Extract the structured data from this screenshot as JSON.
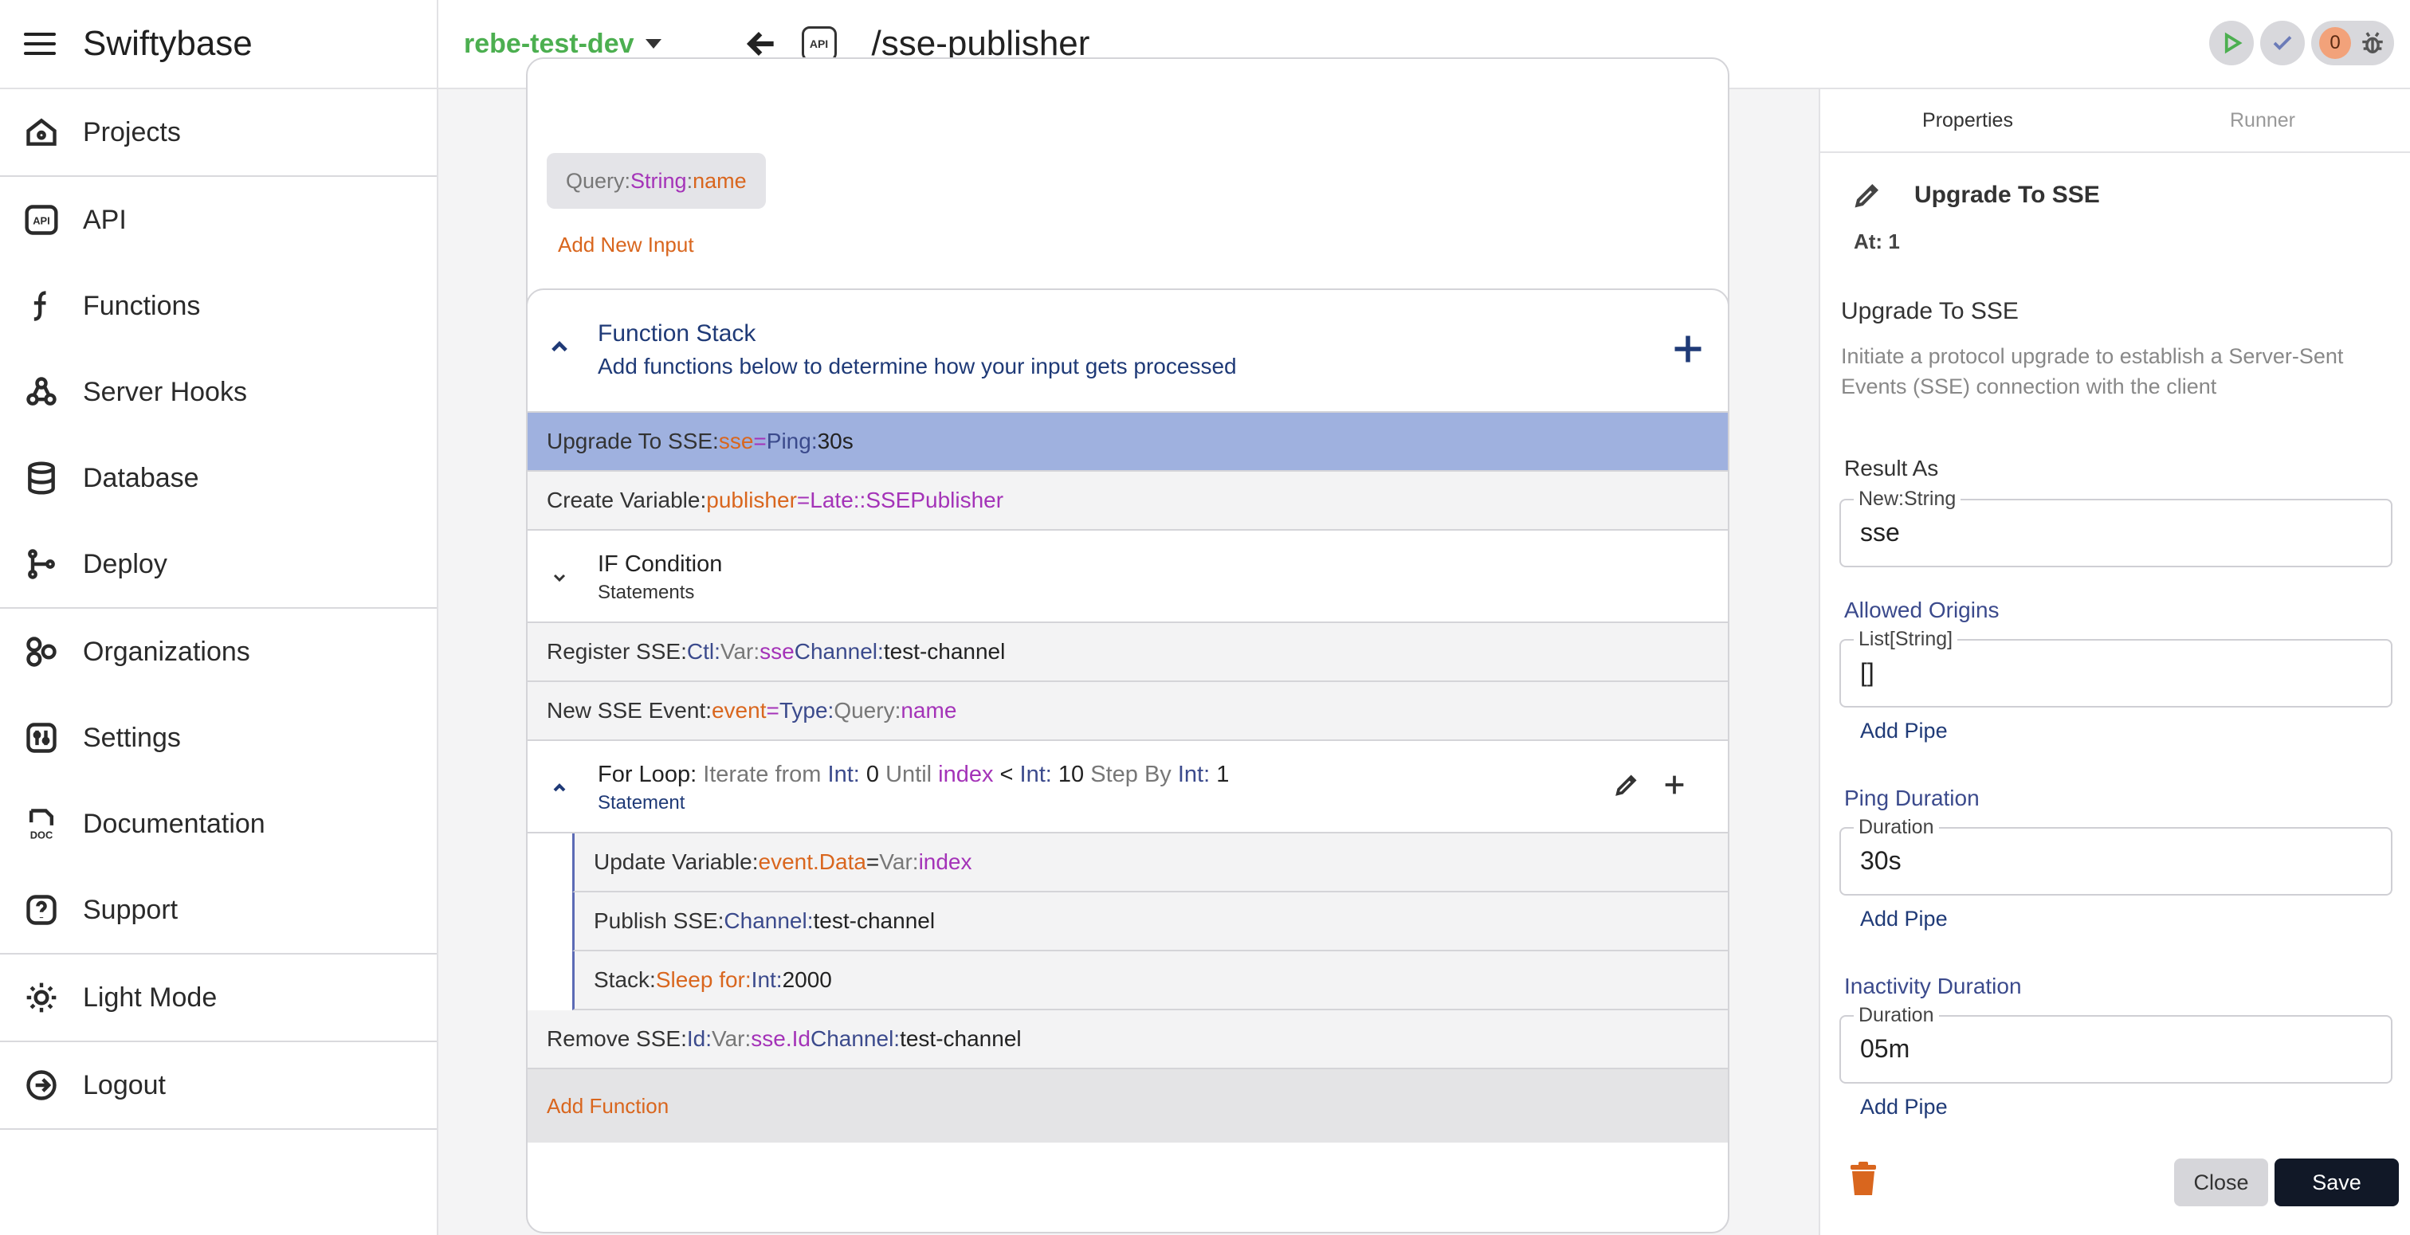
{
  "app": {
    "brand": "Swiftybase"
  },
  "sidebar": {
    "items": [
      {
        "label": "Projects",
        "icon": "home-icon"
      },
      {
        "label": "API",
        "icon": "api-icon"
      },
      {
        "label": "Functions",
        "icon": "function-icon"
      },
      {
        "label": "Server Hooks",
        "icon": "webhook-icon"
      },
      {
        "label": "Database",
        "icon": "database-icon"
      },
      {
        "label": "Deploy",
        "icon": "git-branch-icon"
      },
      {
        "label": "Organizations",
        "icon": "organization-icon"
      },
      {
        "label": "Settings",
        "icon": "settings-icon"
      },
      {
        "label": "Documentation",
        "icon": "doc-icon"
      },
      {
        "label": "Support",
        "icon": "help-icon"
      },
      {
        "label": "Light Mode",
        "icon": "sun-icon"
      },
      {
        "label": "Logout",
        "icon": "logout-icon"
      }
    ]
  },
  "topbar": {
    "project": "rebe-test-dev",
    "api_badge": "API",
    "path": "/sse-publisher",
    "error_count": "0"
  },
  "inputs": {
    "chip": {
      "k": "Query: ",
      "type": "String",
      "sep": ": ",
      "name": "name"
    },
    "add_label": "Add New Input"
  },
  "stack": {
    "title": "Function Stack",
    "subtitle": "Add functions below to determine how your input gets processed",
    "upgrade": {
      "k": "Upgrade To SSE: ",
      "var": "sse",
      "eq": " = ",
      "ping": "Ping: ",
      "val": "30s"
    },
    "create": {
      "k": "Create Variable: ",
      "var": "publisher",
      "eq": " = ",
      "type": "Late::SSEPublisher"
    },
    "if_cond": {
      "title": "IF Condition",
      "sub": "Statements"
    },
    "register": {
      "k": "Register SSE: ",
      "ctl": "Ctl: ",
      "var_lbl": "Var: ",
      "var": "sse",
      "chan": " Channel: ",
      "chan_val": "test-channel"
    },
    "new_event": {
      "k": "New SSE Event: ",
      "var": "event",
      "eq": " = ",
      "type": "Type: ",
      "query": "Query: ",
      "name": "name"
    },
    "for_loop": {
      "k": "For Loop: ",
      "iterate": "Iterate from ",
      "int1": "Int: ",
      "from": "0",
      "until": " Until ",
      "idx": "index",
      "lt": " < ",
      "int2": "Int: ",
      "to": "10",
      "step": " Step By ",
      "int3": "Int: ",
      "by": "1",
      "sub": "Statement"
    },
    "update": {
      "k": "Update Variable: ",
      "var": "event.Data",
      "eq": " = ",
      "var_lbl": "Var: ",
      "val": "index"
    },
    "publish": {
      "k": "Publish SSE: ",
      "chan": "Channel: ",
      "val": "test-channel"
    },
    "sleep": {
      "k": "Stack: ",
      "fn": "Sleep for: ",
      "int": "Int: ",
      "val": "2000"
    },
    "remove": {
      "k": "Remove SSE: ",
      "id": "Id: ",
      "var_lbl": "Var: ",
      "var": "sse.Id",
      "chan": " Channel: ",
      "val": "test-channel"
    },
    "add_fn": "Add Function"
  },
  "panel": {
    "tabs": [
      "Properties",
      "Runner"
    ],
    "title": "Upgrade To SSE",
    "at": "At: 1",
    "name": "Upgrade To SSE",
    "description": "Initiate a protocol upgrade to establish a Server-Sent Events (SSE) connection with the client",
    "result_as": {
      "label": "Result As",
      "legend": "New:String",
      "value": "sse"
    },
    "allowed_origins": {
      "label": "Allowed Origins",
      "legend": "List[String]",
      "value": "[]"
    },
    "ping": {
      "label": "Ping Duration",
      "legend": "Duration",
      "value": "30s"
    },
    "inactivity": {
      "label": "Inactivity Duration",
      "legend": "Duration",
      "value": "05m"
    },
    "add_pipe": "Add Pipe",
    "close": "Close",
    "save": "Save"
  },
  "colors": {
    "accent_orange": "#d9661e",
    "accent_purple": "#a433b8",
    "accent_navy": "#1f3a77",
    "selected_row": "#9fb1df",
    "project_green": "#4caf50"
  }
}
